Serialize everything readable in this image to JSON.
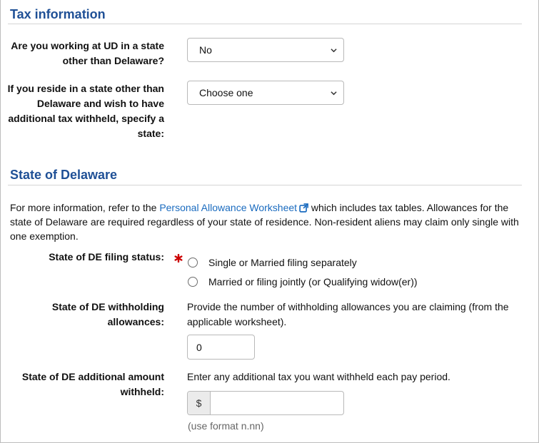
{
  "tax_info": {
    "title": "Tax information",
    "working_state_label": "Are you working at UD in a state other than Delaware?",
    "working_state_value": "No",
    "reside_state_label": "If you reside in a state other than Delaware and wish to have additional tax withheld, specify a state:",
    "reside_state_value": "Choose one"
  },
  "delaware": {
    "title": "State of Delaware",
    "intro_before": "For more information, refer to the ",
    "intro_link": "Personal Allowance Worksheet",
    "intro_after": " which includes tax tables. Allowances for the state of Delaware are required regardless of your state of residence. Non-resident aliens may claim only single with one exemption.",
    "filing_status_label": "State of DE filing status:",
    "filing_options": [
      "Single or Married filing separately",
      "Married or filing jointly (or Qualifying widow(er))"
    ],
    "allowances_label": "State of DE withholding allowances:",
    "allowances_help": "Provide the number of withholding allowances you are claiming (from the applicable worksheet).",
    "allowances_value": "0",
    "additional_label": "State of DE additional amount withheld:",
    "additional_help": "Enter any additional tax you want withheld each pay period.",
    "currency_symbol": "$",
    "additional_value": "",
    "format_hint": "(use format n.nn)"
  },
  "icons": {
    "external_link": "external-link-icon",
    "required": "required-asterisk-icon",
    "dropdown": "chevron-down-icon"
  },
  "colors": {
    "heading": "#1f5096",
    "link": "#1a6bbf",
    "required": "#cc0000"
  }
}
